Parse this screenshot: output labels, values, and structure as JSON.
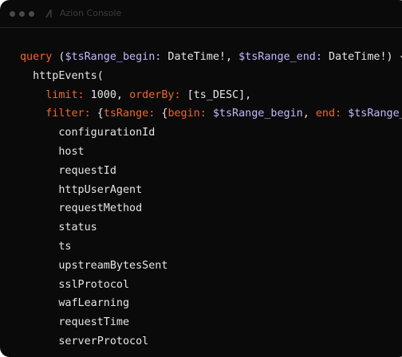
{
  "window": {
    "title": "Azion Console",
    "logo_icon": "azion-logo-icon"
  },
  "colors": {
    "background": "#0a0a0a",
    "keyword": "#f3652b",
    "variable": "#c4b5fd",
    "text": "#e5e5e5",
    "traffic_light": "#4a4a4a"
  },
  "code": {
    "lines": [
      [
        {
          "t": "query ",
          "c": "kw"
        },
        {
          "t": "(",
          "c": "plain"
        },
        {
          "t": "$tsRange_begin:",
          "c": "var"
        },
        {
          "t": " DateTime!, ",
          "c": "plain"
        },
        {
          "t": "$tsRange_end:",
          "c": "var"
        },
        {
          "t": " DateTime!) {",
          "c": "plain"
        }
      ],
      [
        {
          "t": "  httpEvents(",
          "c": "plain"
        }
      ],
      [
        {
          "t": "    limit:",
          "c": "kw"
        },
        {
          "t": " 1000, ",
          "c": "plain"
        },
        {
          "t": "orderBy:",
          "c": "kw"
        },
        {
          "t": " [ts_DESC],",
          "c": "plain"
        }
      ],
      [
        {
          "t": "    filter:",
          "c": "kw"
        },
        {
          "t": " {",
          "c": "plain"
        },
        {
          "t": "tsRange:",
          "c": "kw"
        },
        {
          "t": " {",
          "c": "plain"
        },
        {
          "t": "begin:",
          "c": "kw"
        },
        {
          "t": " ",
          "c": "plain"
        },
        {
          "t": "$tsRange_begin",
          "c": "var"
        },
        {
          "t": ", ",
          "c": "plain"
        },
        {
          "t": "end:",
          "c": "kw"
        },
        {
          "t": " ",
          "c": "plain"
        },
        {
          "t": "$tsRange_end",
          "c": "var"
        },
        {
          "t": "}}",
          "c": "plain"
        }
      ],
      [
        {
          "t": "      configurationId",
          "c": "plain"
        }
      ],
      [
        {
          "t": "      host",
          "c": "plain"
        }
      ],
      [
        {
          "t": "      requestId",
          "c": "plain"
        }
      ],
      [
        {
          "t": "      httpUserAgent",
          "c": "plain"
        }
      ],
      [
        {
          "t": "      requestMethod",
          "c": "plain"
        }
      ],
      [
        {
          "t": "      status",
          "c": "plain"
        }
      ],
      [
        {
          "t": "      ts",
          "c": "plain"
        }
      ],
      [
        {
          "t": "      upstreamBytesSent",
          "c": "plain"
        }
      ],
      [
        {
          "t": "      sslProtocol",
          "c": "plain"
        }
      ],
      [
        {
          "t": "      wafLearning",
          "c": "plain"
        }
      ],
      [
        {
          "t": "      requestTime",
          "c": "plain"
        }
      ],
      [
        {
          "t": "      serverProtocol",
          "c": "plain"
        }
      ]
    ]
  }
}
